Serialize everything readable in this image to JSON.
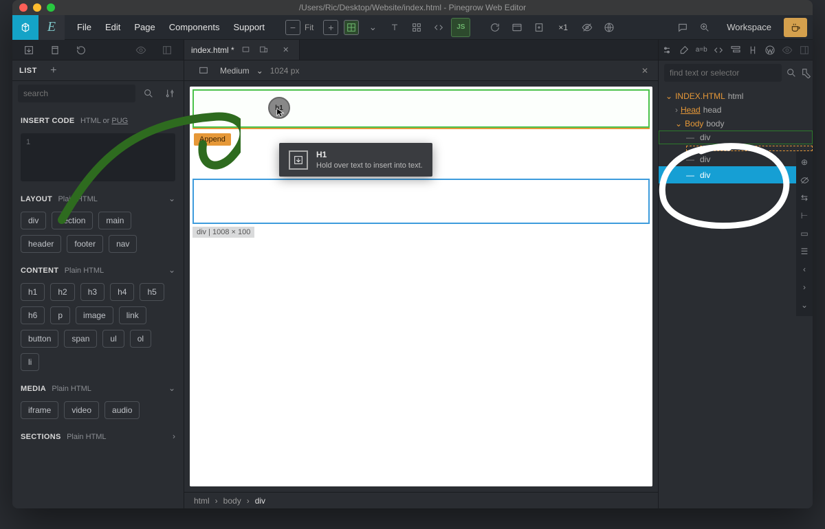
{
  "window": {
    "title": "/Users/Ric/Desktop/Website/index.html - Pinegrow Web Editor"
  },
  "menubar": {
    "items": [
      "File",
      "Edit",
      "Page",
      "Components",
      "Support"
    ],
    "fit_label": "Fit",
    "zoom_label": "×1",
    "workspace_label": "Workspace"
  },
  "left": {
    "tab_list": "LIST",
    "search_placeholder": "search",
    "insert_code": {
      "title": "INSERT CODE",
      "sub_html": "HTML",
      "sub_or": " or ",
      "sub_pug": "PUG",
      "line": "1"
    },
    "layout": {
      "title": "LAYOUT",
      "sub": "Plain HTML",
      "tags": [
        "div",
        "section",
        "main",
        "header",
        "footer",
        "nav"
      ]
    },
    "content": {
      "title": "CONTENT",
      "sub": "Plain HTML",
      "tags": [
        "h1",
        "h2",
        "h3",
        "h4",
        "h5",
        "h6",
        "p",
        "image",
        "link",
        "button",
        "span",
        "ul",
        "ol",
        "li"
      ]
    },
    "media": {
      "title": "MEDIA",
      "sub": "Plain HTML",
      "tags": [
        "iframe",
        "video",
        "audio"
      ]
    },
    "sections": {
      "title": "SECTIONS",
      "sub": "Plain HTML"
    }
  },
  "center": {
    "tab_name": "index.html *",
    "viewport_label": "Medium",
    "viewport_px": "1024 px",
    "append_label": "Append",
    "tooltip_title": "H1",
    "tooltip_body": "Hold over text to insert into text.",
    "drag_label": "h1",
    "size_readout": "div | 1008 × 100",
    "breadcrumb": [
      "html",
      "body",
      "div"
    ]
  },
  "right": {
    "search_placeholder": "find text or selector",
    "tree": {
      "file": "INDEX.HTML",
      "root": "html",
      "head": {
        "label": "Head",
        "el": "head"
      },
      "body": {
        "label": "Body",
        "el": "body"
      },
      "children": [
        "div",
        "div",
        "div"
      ]
    }
  }
}
